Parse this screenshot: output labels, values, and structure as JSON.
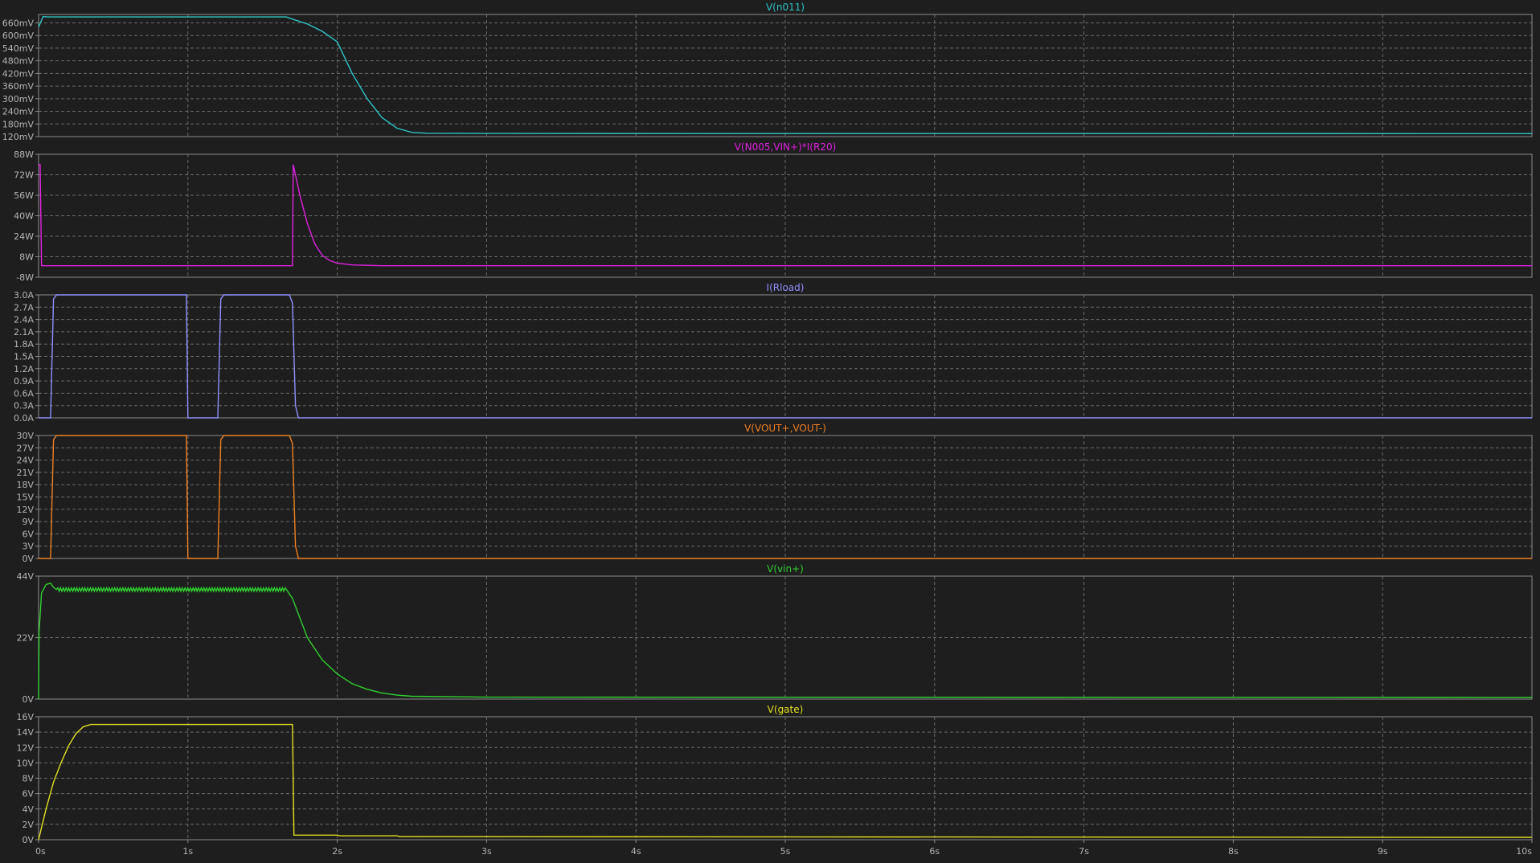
{
  "chart_data": [
    {
      "type": "line",
      "title": "V(n011)",
      "color": "#2ec4c4",
      "ylim": [
        120,
        700
      ],
      "yticks": [
        660,
        600,
        540,
        480,
        420,
        360,
        300,
        240,
        180,
        120
      ],
      "ytick_labels": [
        "660mV",
        "600mV",
        "540mV",
        "480mV",
        "420mV",
        "360mV",
        "300mV",
        "240mV",
        "180mV",
        "120mV"
      ],
      "points": [
        [
          0,
          640
        ],
        [
          0.03,
          690
        ],
        [
          0.06,
          688
        ],
        [
          0.3,
          688
        ],
        [
          1.2,
          688
        ],
        [
          1.66,
          688
        ],
        [
          1.7,
          678
        ],
        [
          1.8,
          655
        ],
        [
          1.9,
          620
        ],
        [
          2.0,
          570
        ],
        [
          2.1,
          420
        ],
        [
          2.2,
          300
        ],
        [
          2.3,
          210
        ],
        [
          2.4,
          160
        ],
        [
          2.5,
          140
        ],
        [
          2.6,
          136
        ],
        [
          3.0,
          135
        ],
        [
          10,
          134
        ]
      ]
    },
    {
      "type": "line",
      "title": "V(N005,VIN+)*I(R20)",
      "color": "#e020e0",
      "ylim": [
        -8,
        88
      ],
      "yticks": [
        88,
        72,
        56,
        40,
        24,
        8,
        -8
      ],
      "ytick_labels": [
        "88W",
        "72W",
        "56W",
        "40W",
        "24W",
        "8W",
        "-8W"
      ],
      "points": [
        [
          0,
          80
        ],
        [
          0.01,
          80
        ],
        [
          0.02,
          1
        ],
        [
          1.7,
          1
        ],
        [
          1.705,
          80
        ],
        [
          1.72,
          72
        ],
        [
          1.75,
          56
        ],
        [
          1.8,
          34
        ],
        [
          1.85,
          18
        ],
        [
          1.9,
          9
        ],
        [
          1.95,
          5
        ],
        [
          2.0,
          3
        ],
        [
          2.1,
          1.6
        ],
        [
          2.3,
          1
        ],
        [
          10,
          1
        ]
      ]
    },
    {
      "type": "line",
      "title": "I(Rload)",
      "color": "#9090ff",
      "ylim": [
        0,
        3.0
      ],
      "yticks": [
        3.0,
        2.7,
        2.4,
        2.1,
        1.8,
        1.5,
        1.2,
        0.9,
        0.6,
        0.3,
        0.0
      ],
      "ytick_labels": [
        "3.0A",
        "2.7A",
        "2.4A",
        "2.1A",
        "1.8A",
        "1.5A",
        "1.2A",
        "0.9A",
        "0.6A",
        "0.3A",
        "0.0A"
      ],
      "points": [
        [
          0,
          0
        ],
        [
          0.08,
          0
        ],
        [
          0.1,
          2.9
        ],
        [
          0.12,
          3.0
        ],
        [
          0.99,
          3.0
        ],
        [
          1.0,
          0
        ],
        [
          1.2,
          0
        ],
        [
          1.22,
          2.9
        ],
        [
          1.24,
          3.0
        ],
        [
          1.68,
          3.0
        ],
        [
          1.7,
          2.8
        ],
        [
          1.72,
          0.3
        ],
        [
          1.74,
          0
        ],
        [
          10,
          0
        ]
      ]
    },
    {
      "type": "line",
      "title": "V(VOUT+,VOUT-)",
      "color": "#f08020",
      "ylim": [
        0,
        30
      ],
      "yticks": [
        30,
        27,
        24,
        21,
        18,
        15,
        12,
        9,
        6,
        3,
        0
      ],
      "ytick_labels": [
        "30V",
        "27V",
        "24V",
        "21V",
        "18V",
        "15V",
        "12V",
        "9V",
        "6V",
        "3V",
        "0V"
      ],
      "points": [
        [
          0,
          0
        ],
        [
          0.08,
          0
        ],
        [
          0.1,
          29
        ],
        [
          0.12,
          30
        ],
        [
          0.99,
          30
        ],
        [
          1.0,
          0
        ],
        [
          1.2,
          0
        ],
        [
          1.22,
          29
        ],
        [
          1.24,
          30
        ],
        [
          1.68,
          30
        ],
        [
          1.7,
          28
        ],
        [
          1.72,
          3
        ],
        [
          1.74,
          0
        ],
        [
          10,
          0
        ]
      ]
    },
    {
      "type": "line",
      "title": "V(vin+)",
      "color": "#30d030",
      "ylim": [
        0,
        44
      ],
      "yticks": [
        44,
        22,
        0
      ],
      "ytick_labels": [
        "44V",
        "22V",
        "0V"
      ],
      "ripple": [
        0.12,
        1.66,
        0.6
      ],
      "points": [
        [
          0,
          0
        ],
        [
          0.003,
          24
        ],
        [
          0.02,
          38
        ],
        [
          0.05,
          41
        ],
        [
          0.08,
          41.5
        ],
        [
          0.1,
          40
        ],
        [
          0.12,
          39.2
        ],
        [
          1.66,
          39.2
        ],
        [
          1.7,
          36
        ],
        [
          1.8,
          22
        ],
        [
          1.9,
          14
        ],
        [
          2.0,
          9
        ],
        [
          2.1,
          5.5
        ],
        [
          2.2,
          3.5
        ],
        [
          2.3,
          2.2
        ],
        [
          2.4,
          1.4
        ],
        [
          2.5,
          1
        ],
        [
          3.0,
          0.7
        ],
        [
          10,
          0.6
        ]
      ]
    },
    {
      "type": "line",
      "title": "V(gate)",
      "color": "#e0e020",
      "ylim": [
        0,
        16
      ],
      "yticks": [
        16,
        14,
        12,
        10,
        8,
        6,
        4,
        2,
        0
      ],
      "ytick_labels": [
        "16V",
        "14V",
        "12V",
        "10V",
        "8V",
        "6V",
        "4V",
        "2V",
        "0V"
      ],
      "points": [
        [
          0,
          0
        ],
        [
          0.05,
          4
        ],
        [
          0.1,
          7.5
        ],
        [
          0.15,
          10
        ],
        [
          0.2,
          12.2
        ],
        [
          0.25,
          13.8
        ],
        [
          0.3,
          14.7
        ],
        [
          0.35,
          15
        ],
        [
          1.7,
          15
        ],
        [
          1.71,
          0.6
        ],
        [
          2.0,
          0.6
        ],
        [
          2.02,
          0.5
        ],
        [
          2.4,
          0.5
        ],
        [
          2.42,
          0.4
        ],
        [
          10,
          0.3
        ]
      ]
    }
  ],
  "xaxis": {
    "xlim": [
      0,
      10
    ],
    "ticks": [
      0,
      1,
      2,
      3,
      4,
      5,
      6,
      7,
      8,
      9,
      10
    ],
    "tick_labels": [
      "0s",
      "1s",
      "2s",
      "3s",
      "4s",
      "5s",
      "6s",
      "7s",
      "8s",
      "9s",
      "10s"
    ]
  },
  "colors": {
    "background": "#1e1e1e",
    "frame": "#8c8c8c",
    "grid": "#6a6a6a",
    "tick_text": "#b4b4b4"
  }
}
